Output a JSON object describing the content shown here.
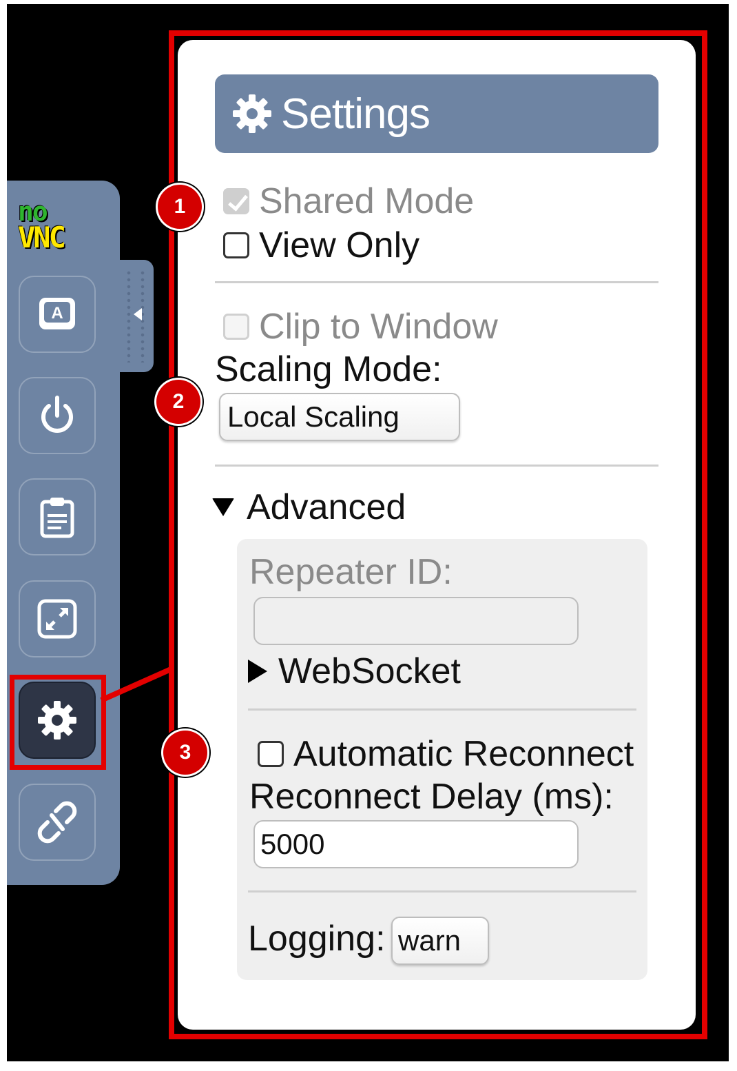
{
  "logo": {
    "no": "no",
    "vnc": "VNC"
  },
  "control_bar": {
    "buttons": [
      {
        "name": "keyboard-button",
        "icon": "keyboard-a-icon"
      },
      {
        "name": "power-button",
        "icon": "power-icon"
      },
      {
        "name": "clipboard-button",
        "icon": "clipboard-icon"
      },
      {
        "name": "fullscreen-button",
        "icon": "fullscreen-icon"
      },
      {
        "name": "settings-button",
        "icon": "gear-icon",
        "active": true
      },
      {
        "name": "disconnect-button",
        "icon": "broken-link-icon"
      }
    ]
  },
  "settings": {
    "title": "Settings",
    "shared_mode": {
      "label": "Shared Mode",
      "checked": true,
      "disabled": true
    },
    "view_only": {
      "label": "View Only",
      "checked": false
    },
    "clip_to_window": {
      "label": "Clip to Window",
      "checked": false,
      "disabled": true
    },
    "scaling_mode": {
      "label": "Scaling Mode:",
      "value": "Local Scaling"
    },
    "advanced": {
      "label": "Advanced",
      "repeater_id": {
        "label": "Repeater ID:",
        "value": ""
      },
      "websocket": {
        "label": "WebSocket"
      },
      "auto_reconnect": {
        "label": "Automatic Reconnect",
        "checked": false
      },
      "reconnect_delay": {
        "label": "Reconnect Delay (ms):",
        "value": "5000"
      },
      "logging": {
        "label": "Logging:",
        "value": "warn"
      }
    }
  },
  "annotations": {
    "badge_1": "1",
    "badge_2": "2",
    "badge_3": "3"
  },
  "colors": {
    "bar": "#6e84a3",
    "highlight": "#e30000",
    "badge": "#d40000"
  }
}
